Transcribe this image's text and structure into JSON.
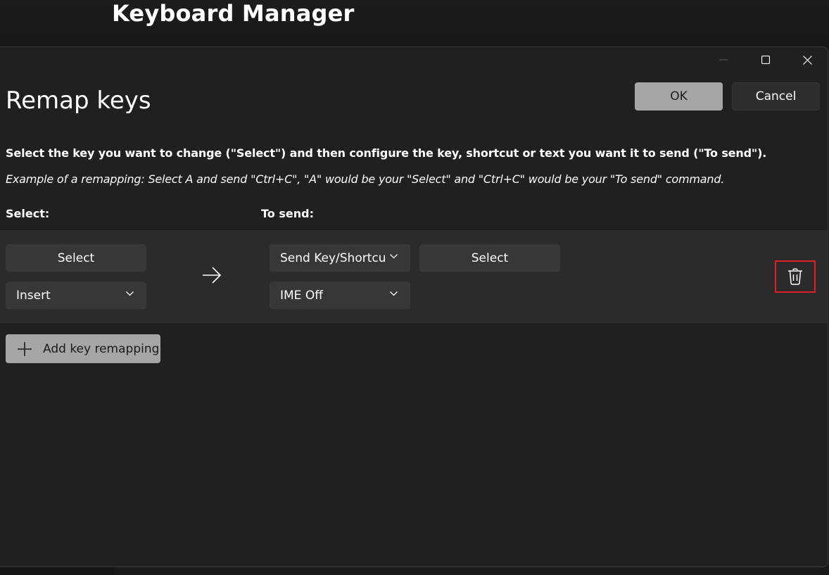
{
  "app": {
    "title": "Keyboard Manager"
  },
  "dialog": {
    "window_controls": {
      "minimize_icon": "minimize-icon",
      "maximize_icon": "maximize-icon",
      "close_icon": "close-icon"
    },
    "heading": "Remap keys",
    "ok_label": "OK",
    "cancel_label": "Cancel",
    "instructions": "Select the key you want to change (\"Select\") and then configure the key, shortcut or text you want it to send (\"To send\").",
    "example": "Example of a remapping: Select A and send \"Ctrl+C\", \"A\" would be your \"Select\" and \"Ctrl+C\" would be your \"To send\" command.",
    "columns": {
      "select": "Select:",
      "to_send": "To send:"
    },
    "mapping": {
      "select_button": "Select",
      "select_key": "Insert",
      "send_type": "Send Key/Shortcu",
      "send_select_button": "Select",
      "send_key": "IME Off",
      "arrow_icon": "arrow-right-icon",
      "delete_icon": "trash-icon"
    },
    "add_label": "Add key remapping",
    "add_icon": "plus-icon"
  },
  "colors": {
    "accent_button": "#a6a6a6",
    "delete_highlight": "#e02020",
    "dialog_bg": "#202020",
    "row_bg": "#2b2b2b"
  }
}
